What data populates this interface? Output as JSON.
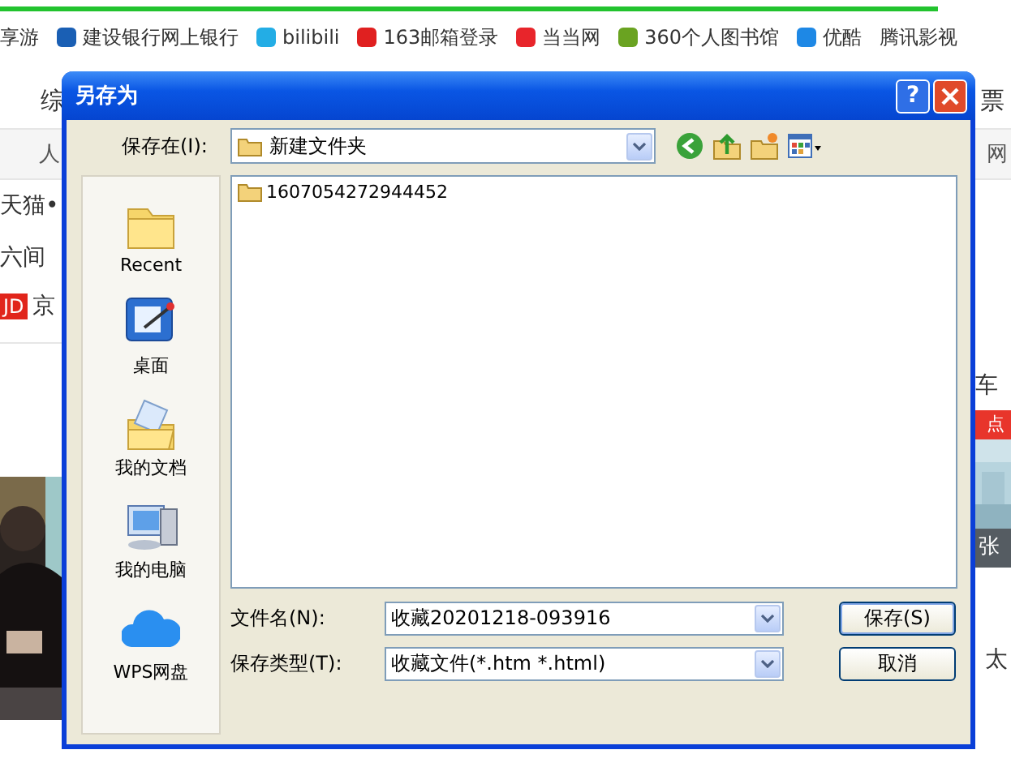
{
  "browser": {
    "bookmarks": [
      {
        "label": "享游"
      },
      {
        "label": "建设银行网上银行",
        "color": "#1a5fb4"
      },
      {
        "label": "bilibili",
        "color": "#23ade5"
      },
      {
        "label": "163邮箱登录",
        "color": "#e02020"
      },
      {
        "label": "当当网",
        "color": "#e8252b"
      },
      {
        "label": "360个人图书馆",
        "color": "#6aa321"
      },
      {
        "label": "优酷",
        "color": "#1e88e5"
      },
      {
        "label": "腾讯影视"
      }
    ],
    "nav": {
      "middle": "综",
      "right": "票"
    },
    "subnav": {
      "left": "人",
      "right": "网"
    },
    "left_column": {
      "lines": [
        "天猫•",
        "六间"
      ],
      "badge": "JD",
      "badge_text": "京"
    },
    "right_column": {
      "text_1": "车",
      "badge": "点",
      "caption": "张",
      "text_2": "太"
    }
  },
  "dialog": {
    "title": "另存为",
    "help_button": "?",
    "save_in": {
      "label": "保存在(I):",
      "value": "新建文件夹"
    },
    "places": [
      {
        "label": "Recent",
        "kind": "recent"
      },
      {
        "label": "桌面",
        "kind": "desktop"
      },
      {
        "label": "我的文档",
        "kind": "documents"
      },
      {
        "label": "我的电脑",
        "kind": "computer"
      },
      {
        "label": "WPS网盘",
        "kind": "cloud"
      }
    ],
    "files": [
      {
        "name": "1607054272944452",
        "kind": "folder"
      }
    ],
    "fields": [
      {
        "label": "文件名(N):",
        "value": "收藏20201218-093916"
      },
      {
        "label": "保存类型(T):",
        "value": "收藏文件(*.htm *.html)"
      }
    ],
    "buttons": [
      "保存(S)",
      "取消"
    ]
  }
}
